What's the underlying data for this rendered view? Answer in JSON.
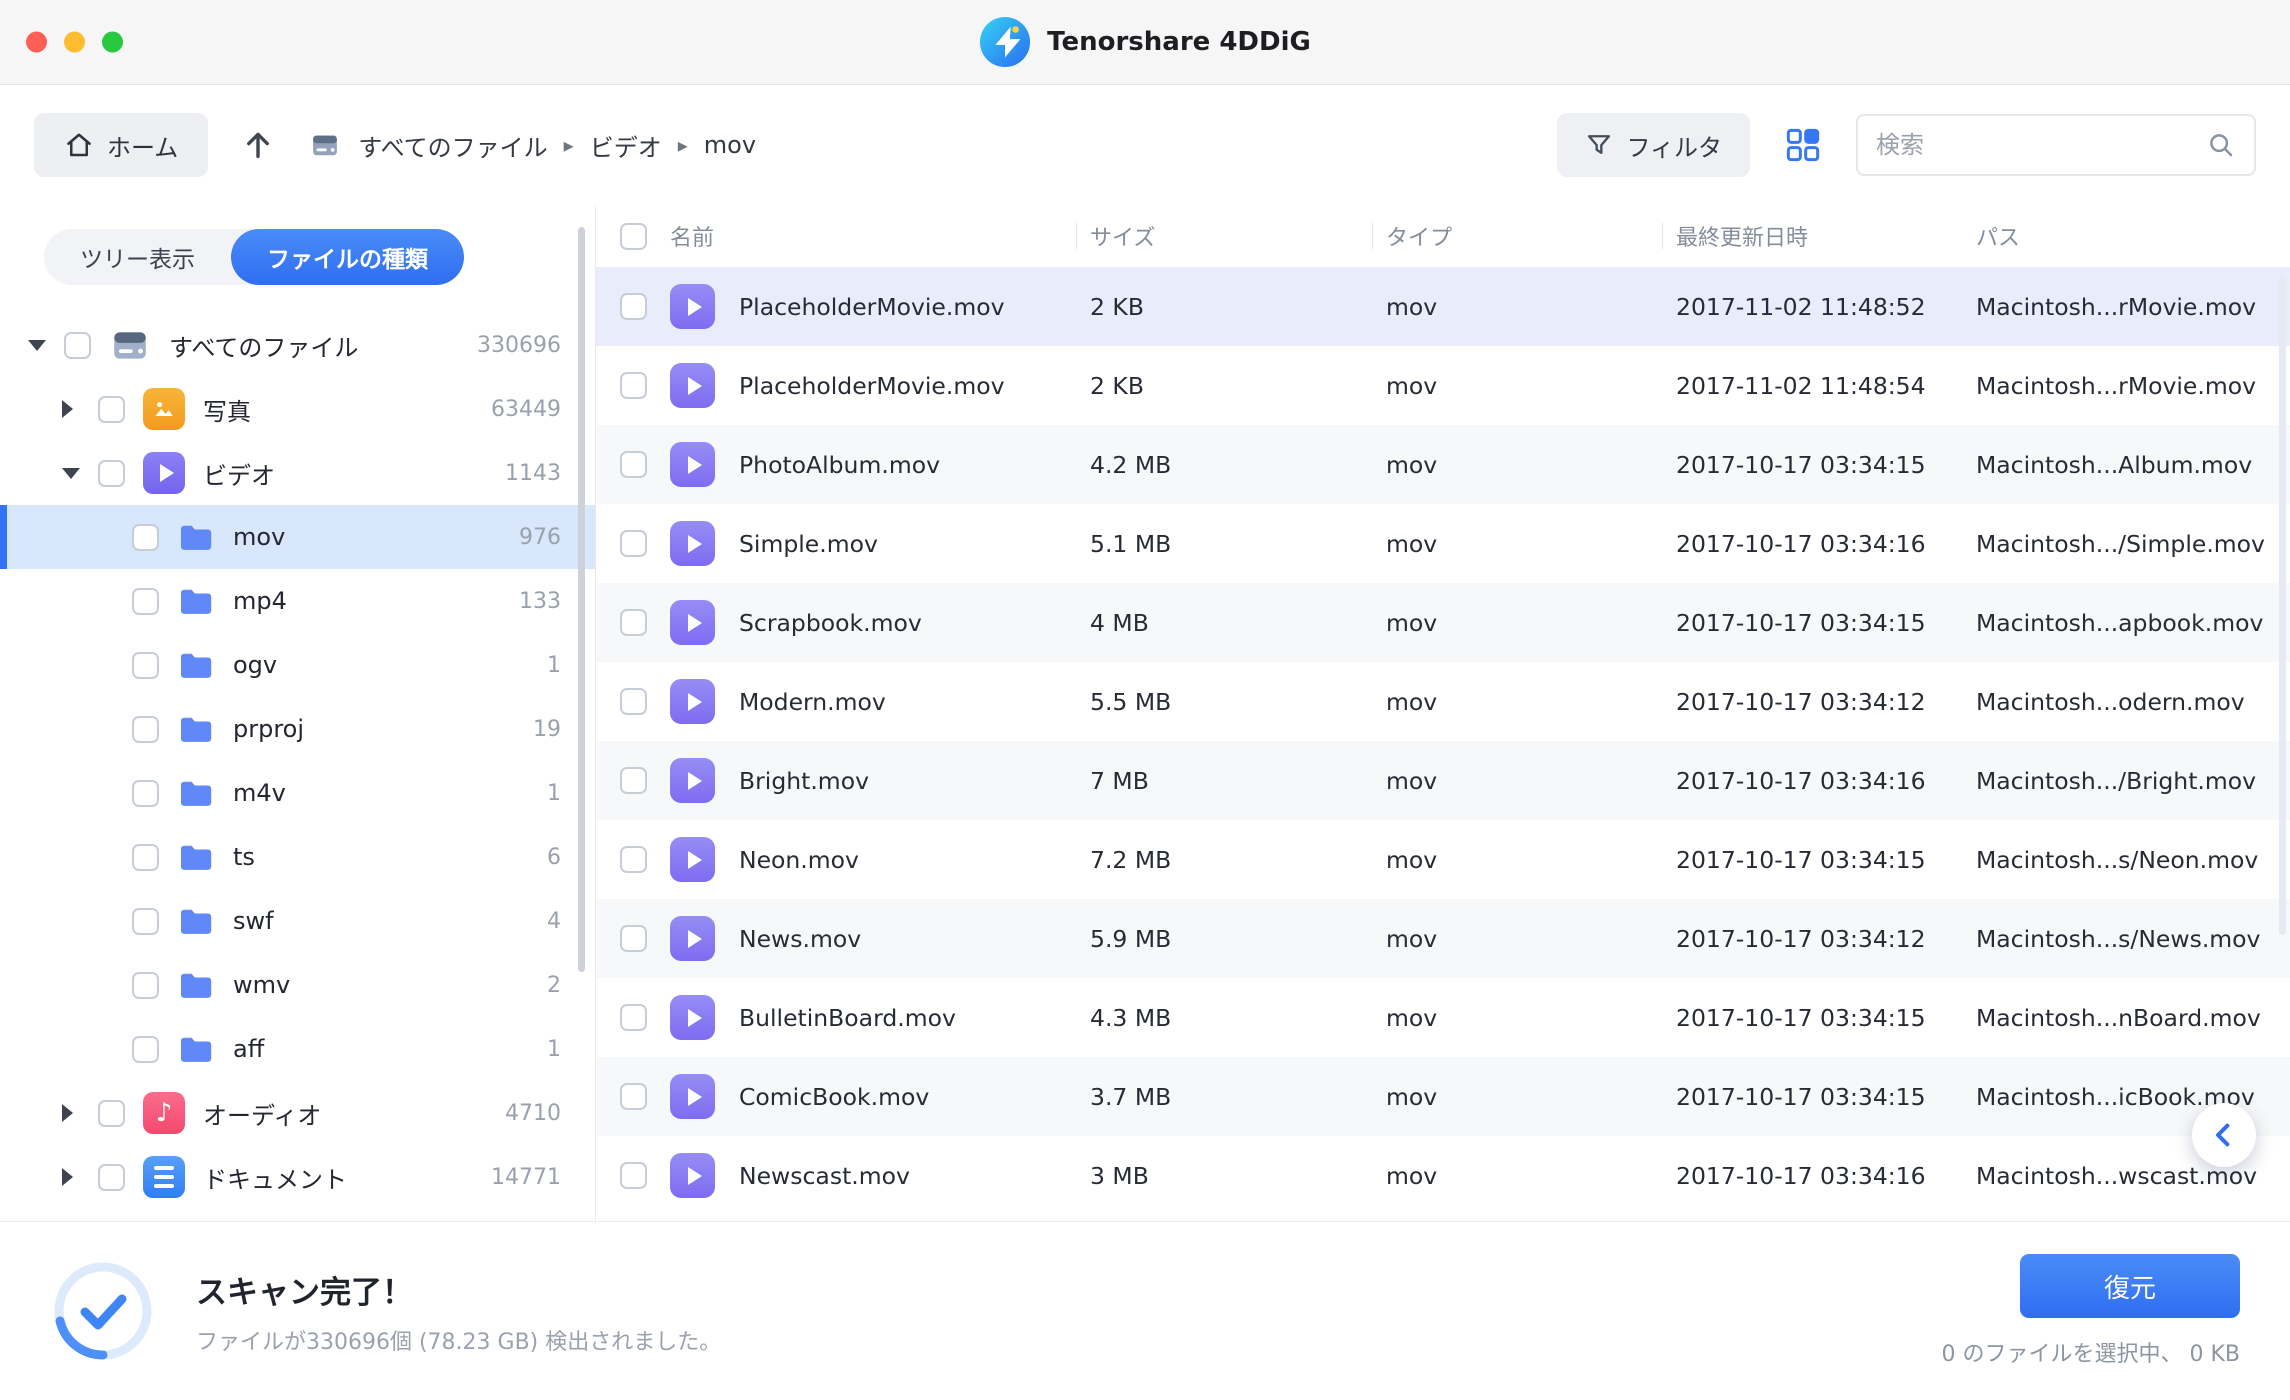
{
  "window": {
    "title": "Tenorshare 4DDiG"
  },
  "toolbar": {
    "home_label": "ホーム",
    "breadcrumb": [
      "すべてのファイル",
      "ビデオ",
      "mov"
    ],
    "filter_label": "フィルタ",
    "search_placeholder": "検索"
  },
  "sidebar": {
    "tabs": [
      {
        "label": "ツリー表示",
        "active": false
      },
      {
        "label": "ファイルの種類",
        "active": true
      }
    ],
    "tree": [
      {
        "label": "すべてのファイル",
        "count": "330696",
        "level": 0,
        "icon": "drive",
        "expanded": true
      },
      {
        "label": "写真",
        "count": "63449",
        "level": 1,
        "icon": "photo",
        "expanded": false
      },
      {
        "label": "ビデオ",
        "count": "1143",
        "level": 1,
        "icon": "video",
        "expanded": true
      },
      {
        "label": "mov",
        "count": "976",
        "level": 2,
        "icon": "folder",
        "selected": true
      },
      {
        "label": "mp4",
        "count": "133",
        "level": 2,
        "icon": "folder"
      },
      {
        "label": "ogv",
        "count": "1",
        "level": 2,
        "icon": "folder"
      },
      {
        "label": "prproj",
        "count": "19",
        "level": 2,
        "icon": "folder"
      },
      {
        "label": "m4v",
        "count": "1",
        "level": 2,
        "icon": "folder"
      },
      {
        "label": "ts",
        "count": "6",
        "level": 2,
        "icon": "folder"
      },
      {
        "label": "swf",
        "count": "4",
        "level": 2,
        "icon": "folder"
      },
      {
        "label": "wmv",
        "count": "2",
        "level": 2,
        "icon": "folder"
      },
      {
        "label": "aff",
        "count": "1",
        "level": 2,
        "icon": "folder"
      },
      {
        "label": "オーディオ",
        "count": "4710",
        "level": 1,
        "icon": "audio",
        "expanded": false
      },
      {
        "label": "ドキュメント",
        "count": "14771",
        "level": 1,
        "icon": "document",
        "expanded": false
      }
    ]
  },
  "table": {
    "headers": [
      "名前",
      "サイズ",
      "タイプ",
      "最終更新日時",
      "パス"
    ],
    "rows": [
      {
        "name": "PlaceholderMovie.mov",
        "size": "2 KB",
        "type": "mov",
        "date": "2017-11-02 11:48:52",
        "path": "Macintosh...rMovie.mov",
        "selected": true
      },
      {
        "name": "PlaceholderMovie.mov",
        "size": "2 KB",
        "type": "mov",
        "date": "2017-11-02 11:48:54",
        "path": "Macintosh...rMovie.mov"
      },
      {
        "name": "PhotoAlbum.mov",
        "size": "4.2 MB",
        "type": "mov",
        "date": "2017-10-17 03:34:15",
        "path": "Macintosh...Album.mov"
      },
      {
        "name": "Simple.mov",
        "size": "5.1 MB",
        "type": "mov",
        "date": "2017-10-17 03:34:16",
        "path": "Macintosh.../Simple.mov"
      },
      {
        "name": "Scrapbook.mov",
        "size": "4 MB",
        "type": "mov",
        "date": "2017-10-17 03:34:15",
        "path": "Macintosh...apbook.mov"
      },
      {
        "name": "Modern.mov",
        "size": "5.5 MB",
        "type": "mov",
        "date": "2017-10-17 03:34:12",
        "path": "Macintosh...odern.mov"
      },
      {
        "name": "Bright.mov",
        "size": "7 MB",
        "type": "mov",
        "date": "2017-10-17 03:34:16",
        "path": "Macintosh.../Bright.mov"
      },
      {
        "name": "Neon.mov",
        "size": "7.2 MB",
        "type": "mov",
        "date": "2017-10-17 03:34:15",
        "path": "Macintosh...s/Neon.mov"
      },
      {
        "name": "News.mov",
        "size": "5.9 MB",
        "type": "mov",
        "date": "2017-10-17 03:34:12",
        "path": "Macintosh...s/News.mov"
      },
      {
        "name": "BulletinBoard.mov",
        "size": "4.3 MB",
        "type": "mov",
        "date": "2017-10-17 03:34:15",
        "path": "Macintosh...nBoard.mov"
      },
      {
        "name": "ComicBook.mov",
        "size": "3.7 MB",
        "type": "mov",
        "date": "2017-10-17 03:34:15",
        "path": "Macintosh...icBook.mov"
      },
      {
        "name": "Newscast.mov",
        "size": "3 MB",
        "type": "mov",
        "date": "2017-10-17 03:34:16",
        "path": "Macintosh...wscast.mov"
      }
    ]
  },
  "footer": {
    "status_title": "スキャン完了！",
    "status_detail": "ファイルが330696個 (78.23 GB) 検出されました。",
    "recover_label": "復元",
    "selection_info": "0 のファイルを選択中、 0 KB"
  },
  "icons": {
    "traffic_lights": [
      "close",
      "minimize",
      "zoom"
    ],
    "home": "house",
    "up": "arrow-up",
    "breadcrumb_drive": "drive",
    "breadcrumb_separator": "▸",
    "filter": "funnel",
    "view_toggle": "grid-2x2",
    "search": "magnifier",
    "video_file": "purple-play-tile",
    "scan_status": "check-circle-progress",
    "collapse": "chevron-left"
  },
  "colors": {
    "accent_blue": "#3173f5",
    "selected_row": "#e9ecfa",
    "sidebar_selected": "#d9e7fc",
    "row_alt": "#f7f8fa",
    "video_icon": "#8578f2",
    "photo_icon": "#f5a62a",
    "audio_icon": "#f65e7e",
    "document_icon": "#3e8bf2",
    "folder_icon": "#6088f6",
    "traffic_red": "#ff5f57",
    "traffic_yellow": "#febc2e",
    "traffic_green": "#28c840"
  }
}
